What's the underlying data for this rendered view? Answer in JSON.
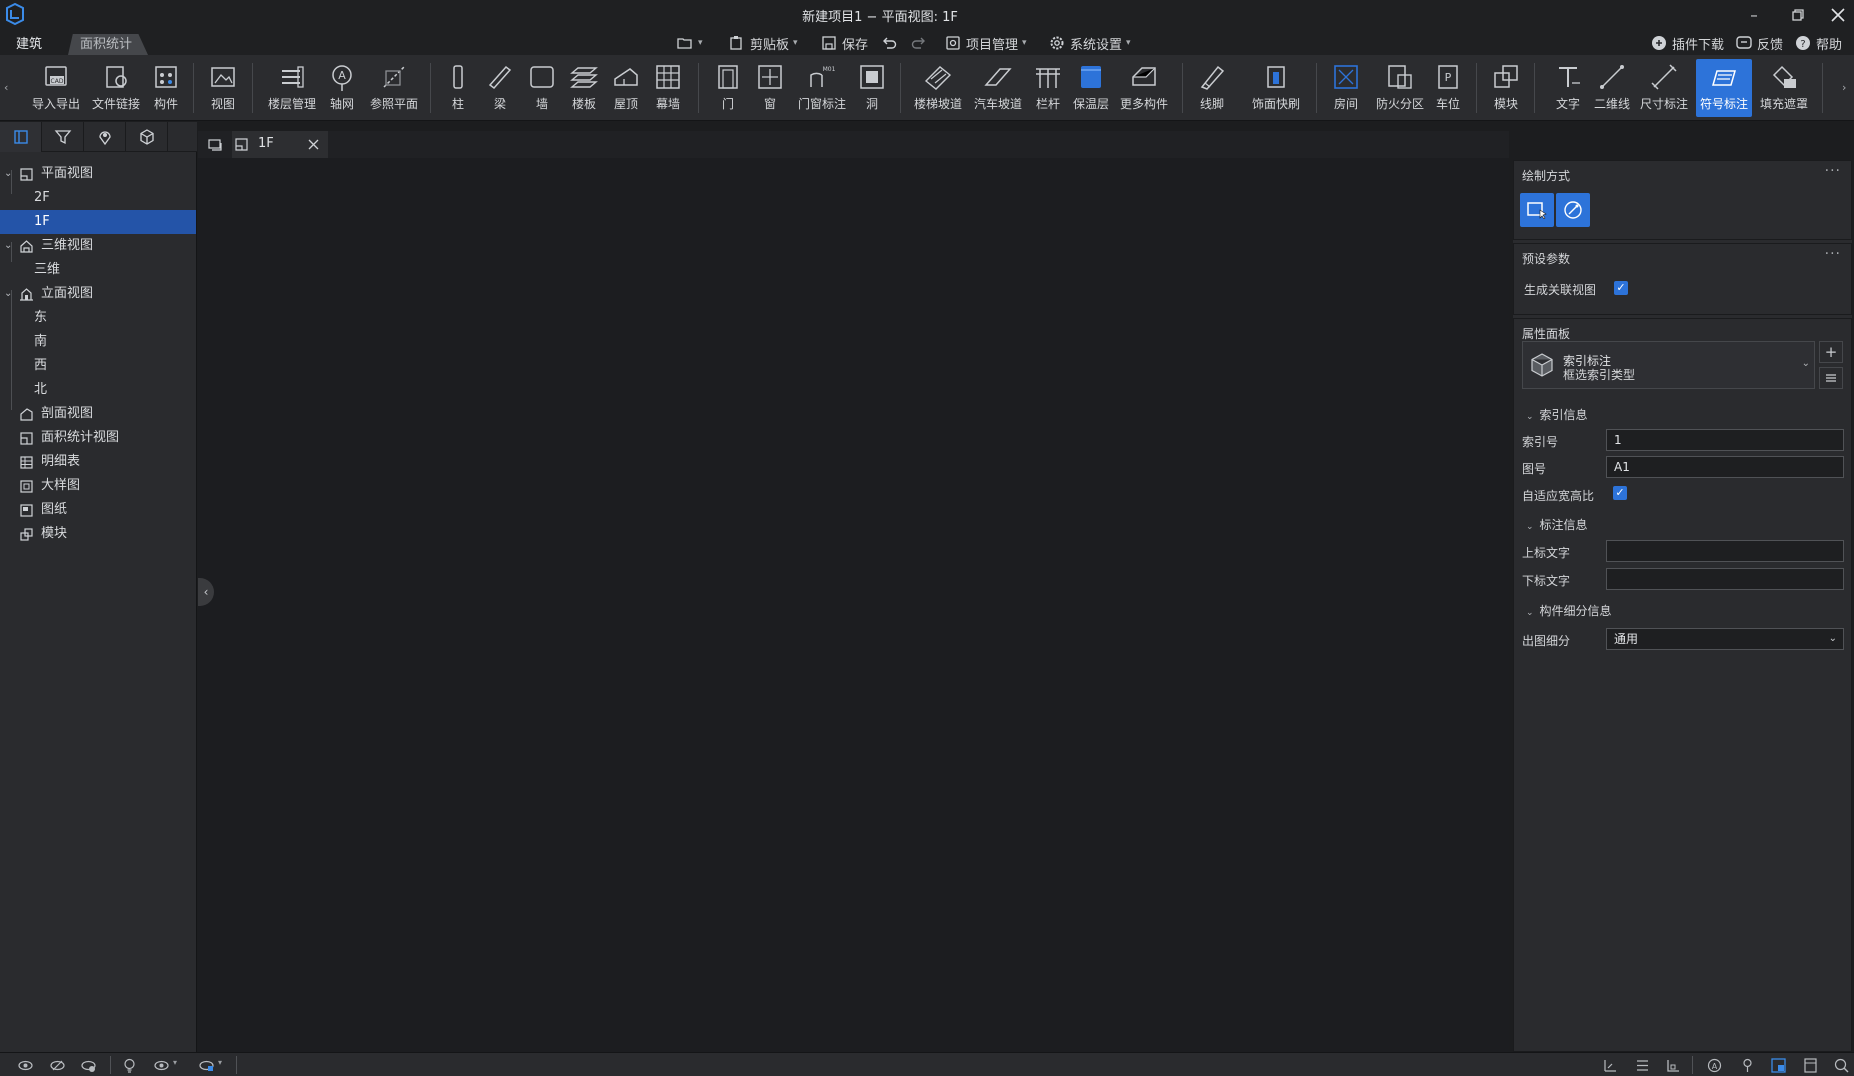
{
  "window": {
    "title": "新建项目1 − 平面视图: 1F"
  },
  "main_tabs": [
    {
      "label": "建筑",
      "active": true
    },
    {
      "label": "面积统计",
      "active": false
    }
  ],
  "quick_access": {
    "clipboard": "剪贴板",
    "save": "保存",
    "project_manage": "项目管理",
    "system_settings": "系统设置"
  },
  "top_right": {
    "plugin": "插件下载",
    "feedback": "反馈",
    "help": "帮助"
  },
  "ribbon": [
    "导入导出",
    "文件链接",
    "构件",
    "视图",
    "楼层管理",
    "轴网",
    "参照平面",
    "柱",
    "梁",
    "墙",
    "楼板",
    "屋顶",
    "幕墙",
    "门",
    "窗",
    "门窗标注",
    "洞",
    "楼梯坡道",
    "汽车坡道",
    "栏杆",
    "保温层",
    "更多构件",
    "线脚",
    "饰面快刷",
    "房间",
    "防火分区",
    "车位",
    "模块",
    "文字",
    "二维线",
    "尺寸标注",
    "符号标注",
    "填充遮罩"
  ],
  "tree": {
    "plan": "平面视图",
    "plan_items": [
      "2F",
      "1F"
    ],
    "threed": "三维视图",
    "threed_items": [
      "三维"
    ],
    "elevation": "立面视图",
    "elevation_items": [
      "东",
      "南",
      "西",
      "北"
    ],
    "section": "剖面视图",
    "area": "面积统计视图",
    "schedule": "明细表",
    "detail": "大样图",
    "sheet": "图纸",
    "module": "模块"
  },
  "doc_tab": {
    "label": "1F"
  },
  "right_panel": {
    "draw_mode_title": "绘制方式",
    "preset_title": "预设参数",
    "gen_view_label": "生成关联视图",
    "gen_view_checked": true,
    "props_title": "属性面板",
    "type_name": "索引标注",
    "type_sub": "框选索引类型",
    "group_index": "索引信息",
    "index_no_label": "索引号",
    "index_no_value": "1",
    "sheet_no_label": "图号",
    "sheet_no_value": "A1",
    "adaptive_label": "自适应宽高比",
    "adaptive_checked": true,
    "group_annot": "标注信息",
    "upper_text_label": "上标文字",
    "upper_text_value": "",
    "lower_text_label": "下标文字",
    "lower_text_value": "",
    "group_detail": "构件细分信息",
    "output_label": "出图细分",
    "output_value": "通用"
  },
  "colors": {
    "accent": "#2d73d9",
    "selection": "#2454a8",
    "panel": "#2a2b2e",
    "canvas": "#1c1d20"
  }
}
